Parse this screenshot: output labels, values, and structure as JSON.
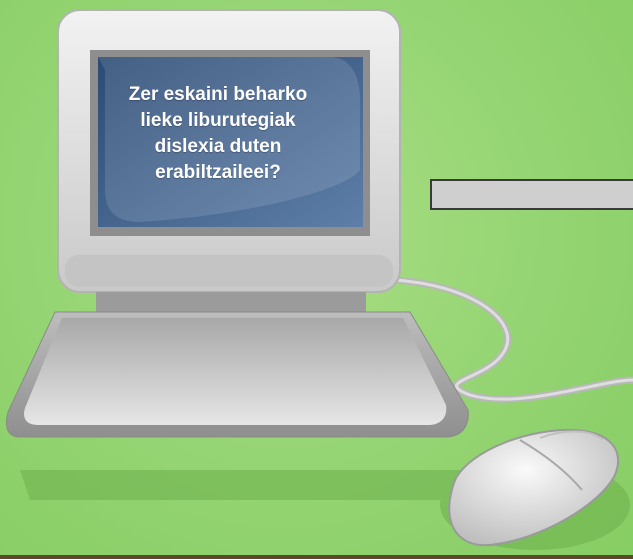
{
  "screen": {
    "question_lines": [
      "Zer eskaini beharko",
      "lieke liburutegiak",
      "dislexia duten",
      "erabiltzaileei?"
    ]
  },
  "colors": {
    "background": "#94d472",
    "screen": "#2f4f7a",
    "computer_body": "#d9d9d9",
    "bar": "#cfcfcf"
  }
}
